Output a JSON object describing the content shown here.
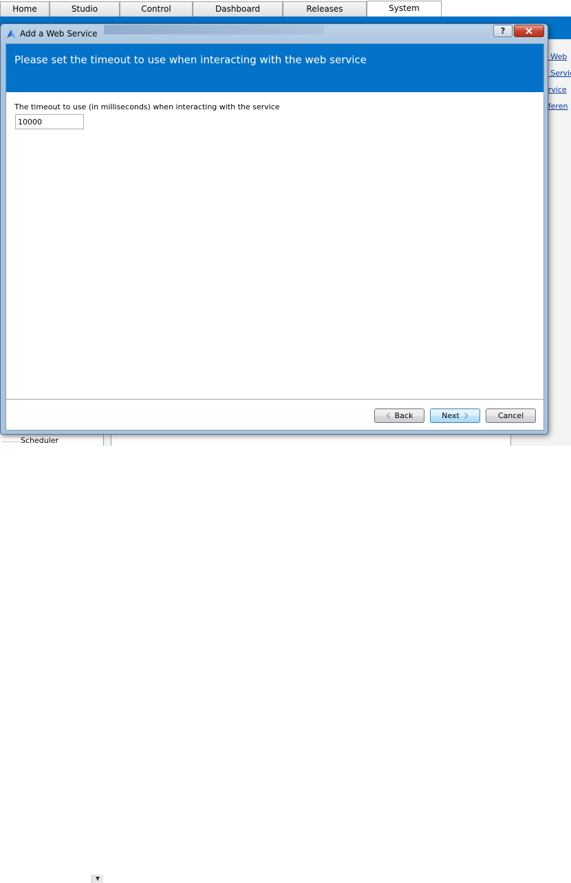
{
  "app": {
    "tabs": [
      "Home",
      "Studio",
      "Control",
      "Dashboard",
      "Releases",
      "System"
    ],
    "active_tab": "System",
    "side_links": [
      "e Web",
      "e Servic",
      "ervice",
      "eferen"
    ],
    "tree_item": "Scheduler"
  },
  "dialog": {
    "title": "Add a Web Service",
    "help_icon": "help-icon",
    "close_icon": "close-icon",
    "banner_text": "Please set the timeout to use when interacting with the web service",
    "timeout_label": "The timeout to use (in milliseconds) when interacting with the service",
    "timeout_value": "10000",
    "buttons": {
      "back": "Back",
      "next": "Next",
      "cancel": "Cancel"
    }
  },
  "colors": {
    "banner": "#0472c8",
    "app_header": "#0472c8"
  }
}
